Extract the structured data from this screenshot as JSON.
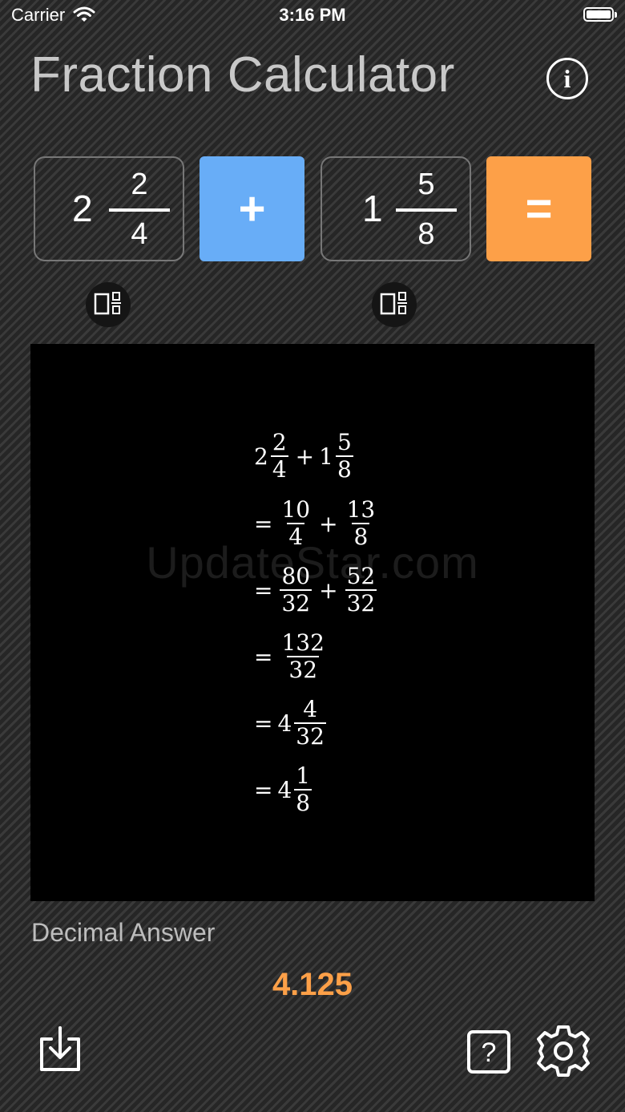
{
  "status": {
    "carrier": "Carrier",
    "time": "3:16 PM"
  },
  "title": "Fraction Calculator",
  "first_fraction": {
    "whole": "2",
    "numerator": "2",
    "denominator": "4"
  },
  "operator": "+",
  "second_fraction": {
    "whole": "1",
    "numerator": "5",
    "denominator": "8"
  },
  "equals": "=",
  "watermark": "UpdateStar.com",
  "steps": {
    "row1": {
      "w1": "2",
      "n1": "2",
      "d1": "4",
      "op": "+",
      "w2": "1",
      "n2": "5",
      "d2": "8"
    },
    "row2": {
      "eq": "=",
      "n1": "10",
      "d1": "4",
      "op": "+",
      "n2": "13",
      "d2": "8"
    },
    "row3": {
      "eq": "=",
      "n1": "80",
      "d1": "32",
      "op": "+",
      "n2": "52",
      "d2": "32"
    },
    "row4": {
      "eq": "=",
      "n1": "132",
      "d1": "32"
    },
    "row5": {
      "eq": "=",
      "w": "4",
      "n": "4",
      "d": "32"
    },
    "row6": {
      "eq": "=",
      "w": "4",
      "n": "1",
      "d": "8"
    }
  },
  "decimal": {
    "label": "Decimal Answer",
    "value": "4.125"
  },
  "icons": [
    "wifi-icon",
    "battery-icon",
    "info-icon",
    "swap-format-icon",
    "share-icon",
    "help-icon",
    "settings-icon"
  ]
}
